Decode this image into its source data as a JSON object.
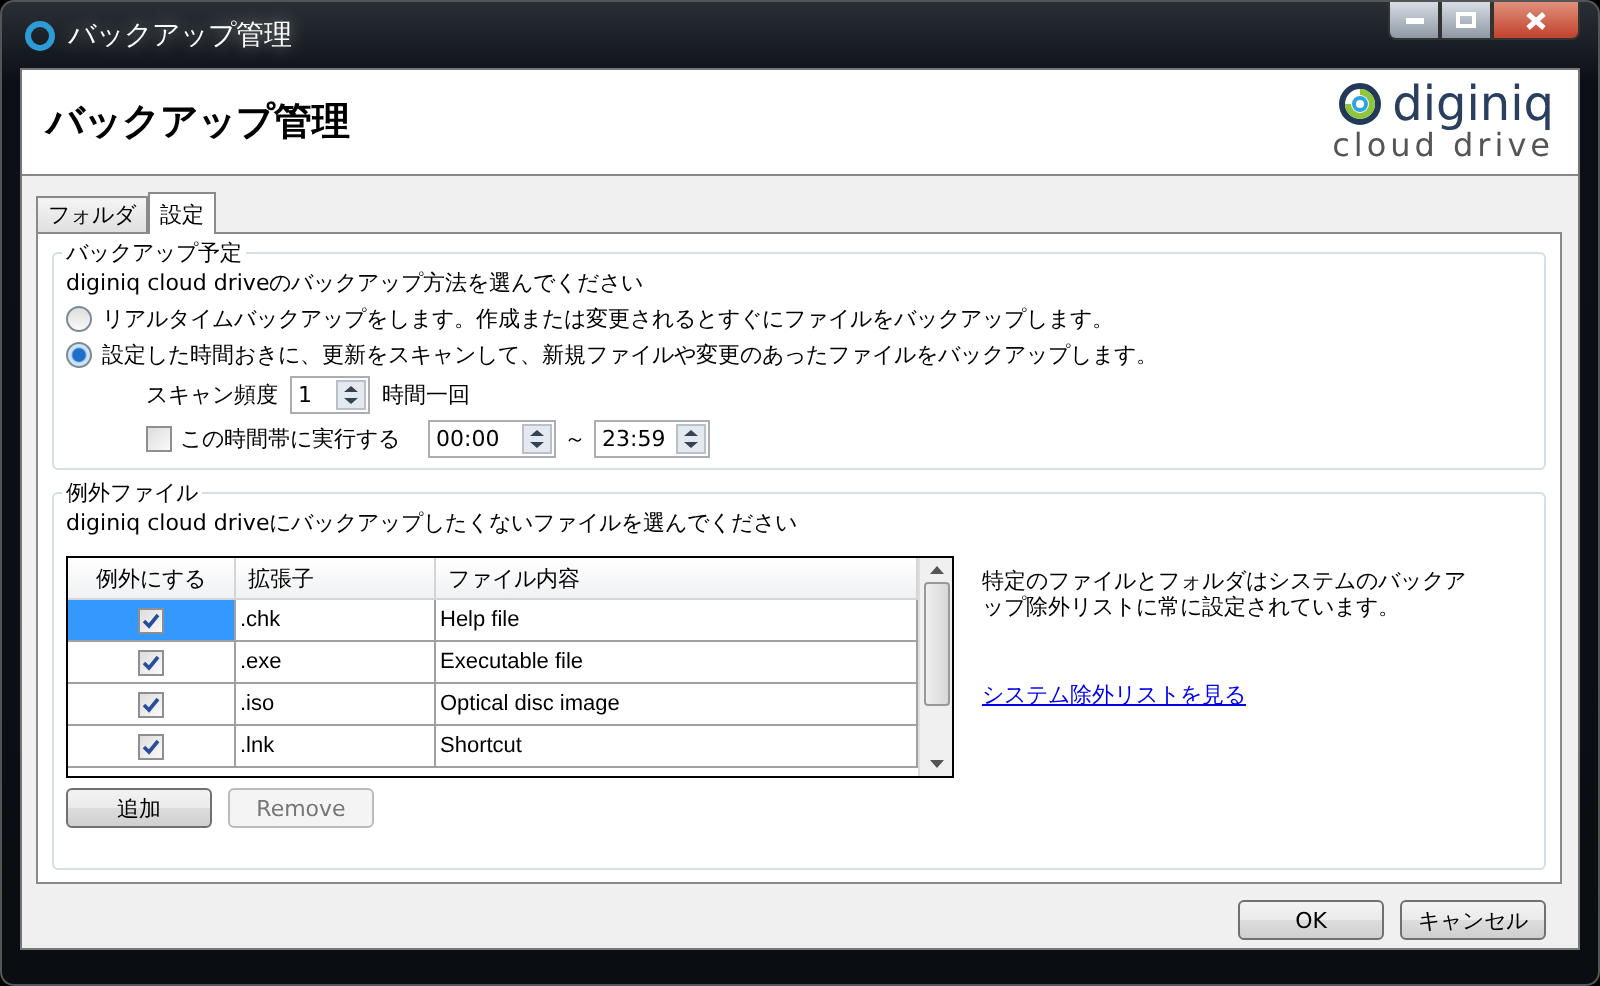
{
  "window": {
    "title": "バックアップ管理"
  },
  "header": {
    "title": "バックアップ管理",
    "logo": {
      "name": "diginiq",
      "tagline": "cloud drive"
    }
  },
  "tabs": [
    {
      "label": "フォルダ",
      "selected": false
    },
    {
      "label": "設定",
      "selected": true
    }
  ],
  "schedule": {
    "legend": "バックアップ予定",
    "prompt": "diginiq cloud driveのバックアップ方法を選んでください",
    "options": [
      {
        "label": "リアルタイムバックアップをします。作成または変更されるとすぐにファイルをバックアップします。",
        "selected": false
      },
      {
        "label": "設定した時間おきに、更新をスキャンして、新規ファイルや変更のあったファイルをバックアップします。",
        "selected": true
      }
    ],
    "frequency": {
      "label": "スキャン頻度",
      "value": "1",
      "unit": "時間一回"
    },
    "window": {
      "label": "この時間帯に実行する",
      "checked": false,
      "from": "00:00",
      "separator": "～",
      "to": "23:59"
    }
  },
  "exclusions": {
    "legend": "例外ファイル",
    "prompt": "diginiq cloud driveにバックアップしたくないファイルを選んでください",
    "table": {
      "columns": [
        "例外にする",
        "拡張子",
        "ファイル内容"
      ],
      "rows": [
        {
          "checked": true,
          "selected": true,
          "extension": ".chk",
          "description": "Help file"
        },
        {
          "checked": true,
          "selected": false,
          "extension": ".exe",
          "description": "Executable file"
        },
        {
          "checked": true,
          "selected": false,
          "extension": ".iso",
          "description": "Optical disc image"
        },
        {
          "checked": true,
          "selected": false,
          "extension": ".lnk",
          "description": "Shortcut"
        }
      ]
    },
    "buttons": [
      {
        "label": "追加",
        "disabled": false
      },
      {
        "label": "Remove",
        "disabled": true
      }
    ],
    "note": "特定のファイルとフォルダはシステムのバックアップ除外リストに常に設定されています。",
    "link": "システム除外リストを見る"
  },
  "footer": {
    "buttons": [
      "OK",
      "キャンセル"
    ]
  }
}
